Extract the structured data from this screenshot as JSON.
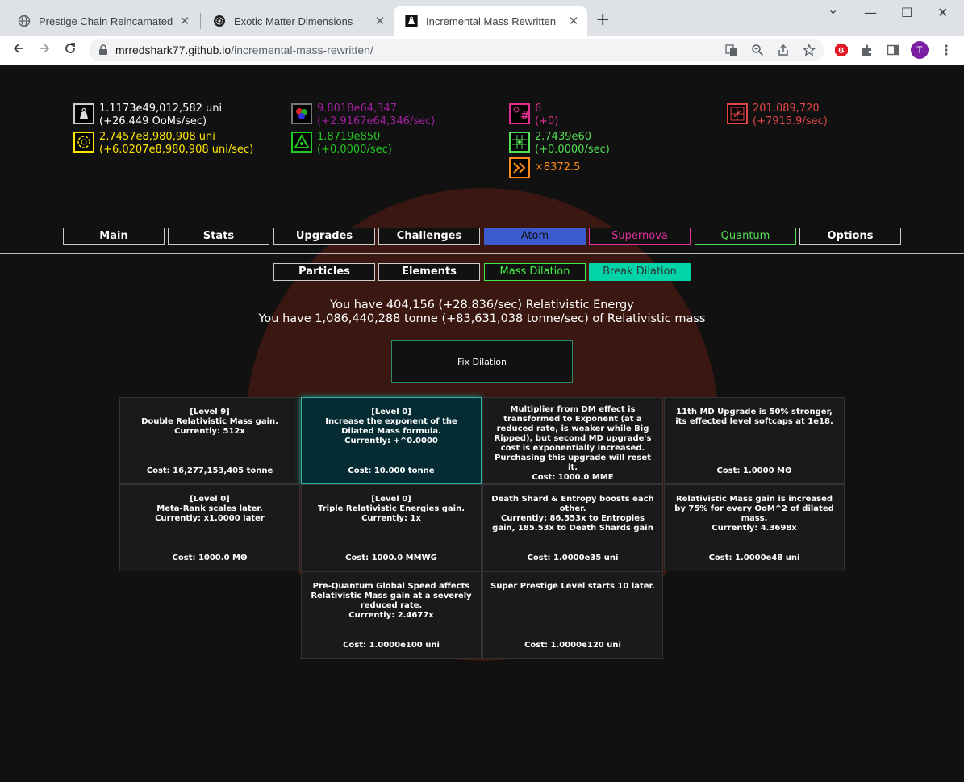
{
  "browser": {
    "tabs": [
      {
        "title": "Prestige Chain Reincarnated",
        "icon": "globe-icon",
        "active": false
      },
      {
        "title": "Exotic Matter Dimensions",
        "icon": "emd-icon",
        "active": false
      },
      {
        "title": "Incremental Mass Rewritten",
        "icon": "mass-icon",
        "active": true
      }
    ],
    "new_tab": "+",
    "window_controls": {
      "dropdown": "⌄",
      "minimize": "—",
      "maximize": "☐",
      "close": "✕"
    },
    "url_host": "mrredshark77.github.io",
    "url_path": "/incremental-mass-rewritten/",
    "profile_initial": "T"
  },
  "resources": {
    "mass": {
      "value": "1.1173e49,012,582 uni",
      "rate": "(+26.449 OoMs/sec)",
      "color": "#ffffff",
      "icon": "weight-icon"
    },
    "black_hole": {
      "value": "2.7457e8,980,908 uni",
      "rate": "(+6.0207e8,980,908 uni/sec)",
      "color": "#ffe600",
      "icon": "black-hole-icon"
    },
    "quarks": {
      "value": "9.8018e64,347",
      "rate": "(+2.9167e64,346/sec)",
      "color": "#a020a0",
      "icon": "quark-icon"
    },
    "dark_matter": {
      "value": "1.8719e850",
      "rate": "(+0.0000/sec)",
      "color": "#22c922",
      "icon": "dark-matter-icon"
    },
    "quantum_foam": {
      "value": "6",
      "rate": "(+0)",
      "color": "#e0308f",
      "icon": "quantum-hash-icon"
    },
    "entropy": {
      "value": "2.7439e60",
      "rate": "(+0.0000/sec)",
      "color": "#55dd55",
      "icon": "entropy-grid-icon"
    },
    "speed": {
      "value": "×8372.5",
      "color": "#ff8c1a",
      "icon": "fast-forward-icon"
    },
    "death_shards": {
      "value": "201,089,720",
      "rate": "(+7915.9/sec)",
      "color": "#e04545",
      "icon": "death-shard-icon"
    }
  },
  "main_tabs": [
    "Main",
    "Stats",
    "Upgrades",
    "Challenges",
    "Atom",
    "Supernova",
    "Quantum",
    "Options"
  ],
  "main_tab_colors": {
    "atom_bg": "#3b5bcf",
    "supernova": "#e0309f",
    "quantum": "#55dd55"
  },
  "sub_tabs": [
    "Particles",
    "Elements",
    "Mass Dilation",
    "Break Dilation"
  ],
  "sub_tab_colors": {
    "mass_dilation": "#44ee44",
    "break_dilation_bg": "#00d4a8"
  },
  "info": {
    "line1": "You have 404,156 (+28.836/sec) Relativistic Energy",
    "line2": "You have 1,086,440,288 tonne (+83,631,038 tonne/sec) of Relativistic mass"
  },
  "fix_dilation": "Fix Dilation",
  "upgrades": [
    {
      "desc": [
        "[Level 9]",
        "Double Relativistic Mass gain.",
        "Currently: 512x"
      ],
      "cost": "Cost: 16,277,153,405 tonne"
    },
    {
      "desc": [
        "[Level 0]",
        "Increase the exponent of the Dilated Mass formula.",
        "Currently: +^0.0000"
      ],
      "cost": "Cost: 10.000 tonne",
      "highlight": true
    },
    {
      "desc": [
        "Multiplier from DM effect is transformed to Exponent (at a reduced rate, is weaker while Big Ripped), but second MD upgrade's cost is exponentially increased. Purchasing this upgrade will reset it."
      ],
      "cost": "Cost: 1000.0 MME"
    },
    {
      "desc": [
        "11th MD Upgrade is 50% stronger, its effected level softcaps at 1e18."
      ],
      "cost": "Cost: 1.0000 MΘ"
    },
    {
      "desc": [
        "[Level 0]",
        "Meta-Rank scales later.",
        "Currently: x1.0000 later"
      ],
      "cost": "Cost: 1000.0 MΘ"
    },
    {
      "desc": [
        "[Level 0]",
        "Triple Relativistic Energies gain.",
        "Currently: 1x"
      ],
      "cost": "Cost: 1000.0 MMWG"
    },
    {
      "desc": [
        "Death Shard & Entropy boosts each other.",
        "Currently: 86.553x to Entropies gain, 185.53x to Death Shards gain"
      ],
      "cost": "Cost: 1.0000e35 uni"
    },
    {
      "desc": [
        "Relativistic Mass gain is increased by 75% for every OoM^2 of dilated mass.",
        "Currently: 4.3698x"
      ],
      "cost": "Cost: 1.0000e48 uni"
    },
    {
      "desc": [
        "Pre-Quantum Global Speed affects Relativistic Mass gain at a severely reduced rate.",
        "Currently: 2.4677x"
      ],
      "cost": "Cost: 1.0000e100 uni"
    },
    {
      "desc": [
        "Super Prestige Level starts 10 later."
      ],
      "cost": "Cost: 1.0000e120 uni"
    }
  ]
}
